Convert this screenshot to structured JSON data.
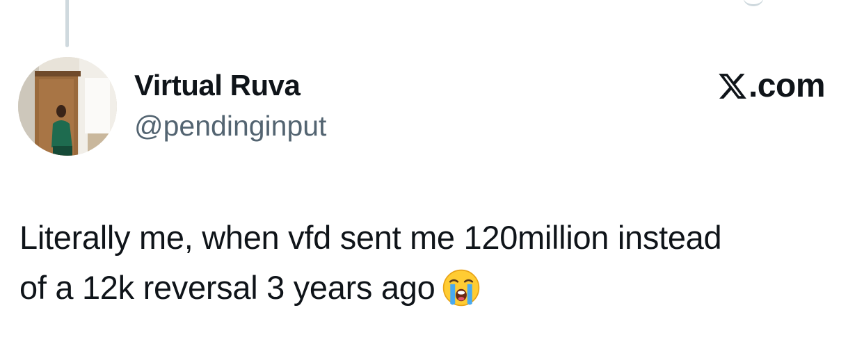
{
  "author": {
    "display_name": "Virtual Ruva",
    "handle": "@pendinginput"
  },
  "brand": {
    "label": ".com",
    "icon": "x-logo-icon"
  },
  "tweet": {
    "lines": [
      "Literally me, when vfd sent me 120million instead",
      "of a 12k reversal 3 years ago"
    ],
    "emoji": "loudly-crying-face-icon"
  },
  "colors": {
    "text": "#0f1419",
    "secondary_text": "#536471",
    "thread_line": "#cfd9de",
    "background": "#ffffff"
  }
}
